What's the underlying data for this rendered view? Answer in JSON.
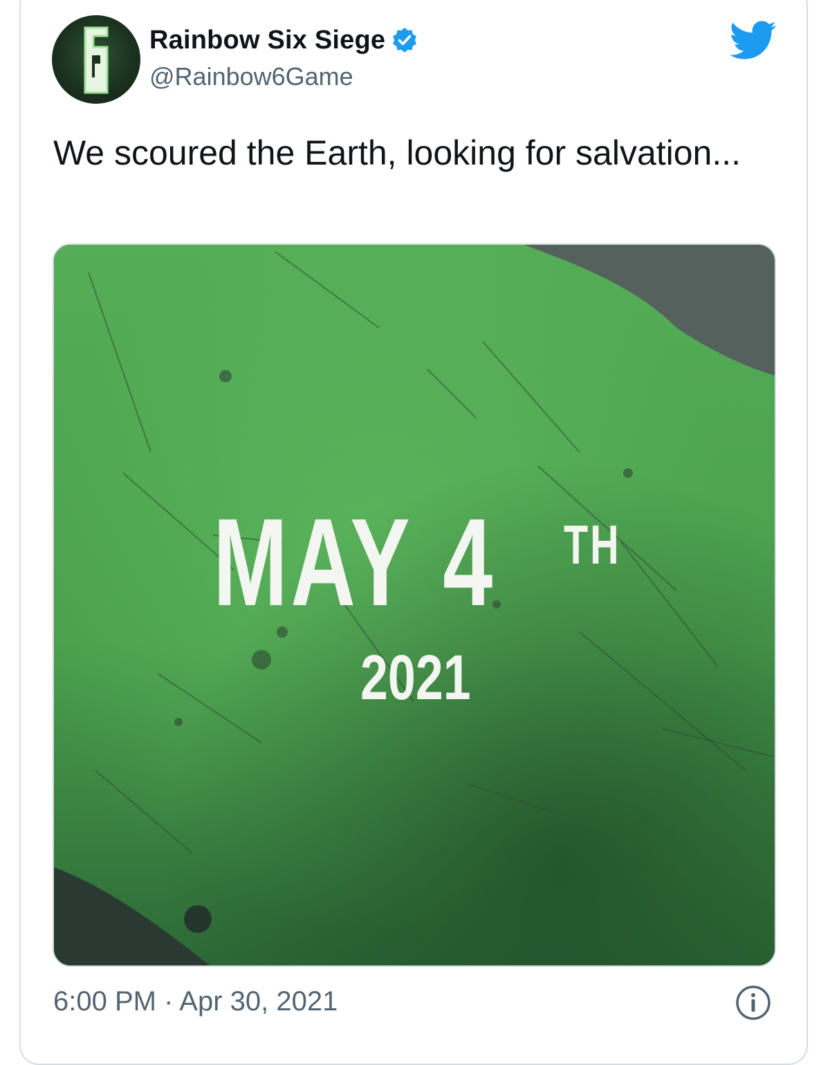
{
  "tweet": {
    "author": {
      "display_name": "Rainbow Six Siege",
      "handle": "@Rainbow6Game",
      "verified": true,
      "avatar_icon": "rainbow-six-logo-icon"
    },
    "platform_icon": "twitter-bird-icon",
    "text": "We scoured the Earth, looking for salvation...",
    "media": {
      "date_main": "MAY",
      "date_number": "4",
      "date_suffix": "TH",
      "year": "2021",
      "background_colors": {
        "green_light": "#5ab35b",
        "green_dark": "#2f6e38",
        "gray": "#4f5a55"
      }
    },
    "timestamp": "6:00 PM · Apr 30, 2021",
    "info_icon": "info-icon"
  },
  "colors": {
    "twitter_blue": "#1d9bf0",
    "text_primary": "#0f1419",
    "text_secondary": "#536471",
    "border": "#cfd9de"
  }
}
